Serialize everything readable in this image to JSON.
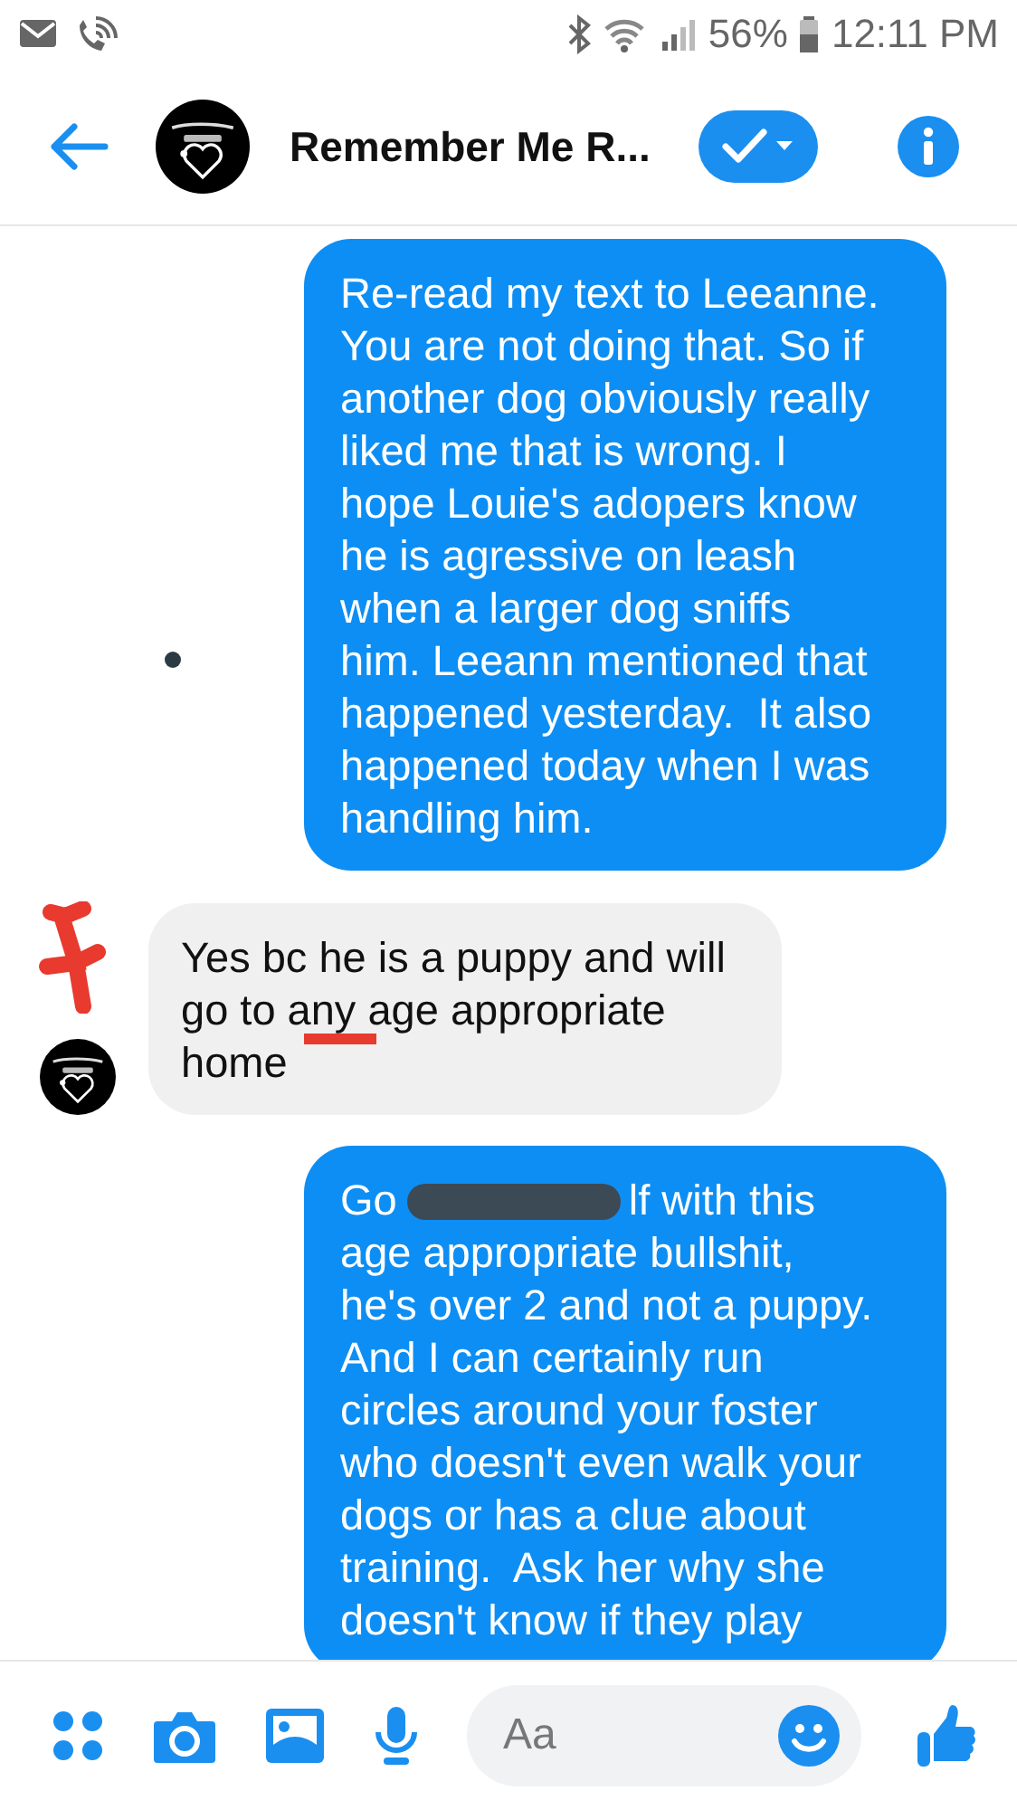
{
  "status_bar": {
    "battery": "56%",
    "time": "12:11 PM"
  },
  "header": {
    "title": "Remember Me R..."
  },
  "messages": [
    {
      "kind": "sent",
      "text": "Re-read my text to Leeanne.\nYou are not doing that. So if\nanother dog obviously really\nliked me that is wrong. I\nhope Louie's adopers know\nhe is agressive on leash\nwhen a larger dog sniffs\nhim. Leeann mentioned that\nhappened yesterday.  It also\nhappened today when I was\nhandling him."
    },
    {
      "kind": "received",
      "text": "Yes bc he is a puppy and will\ngo to any age appropriate\nhome"
    },
    {
      "kind": "sent",
      "redacted": true,
      "text_before": "Go",
      "text_after": "lf with this",
      "text": "age appropriate bullshit,\nhe's over 2 and not a puppy.\nAnd I can certainly run\ncircles around your foster\nwho doesn't even walk your\ndogs or has a clue about\ntraining.  Ask her why she\ndoesn't know if they play"
    }
  ],
  "composer": {
    "placeholder": "Aa"
  }
}
